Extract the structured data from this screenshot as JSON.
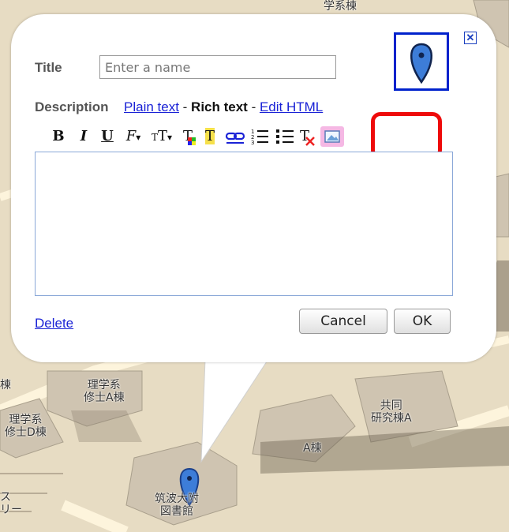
{
  "map": {
    "labels": {
      "top_building": "学系棟",
      "rigaku_shushi_a": "理学系\n修士A棟",
      "rigaku_shushi_d": "理学系\n修士D棟",
      "kyodo_kenkyu_a": "共同\n研究棟A",
      "a_building": "A棟",
      "library": "筑波大附\n図書館",
      "left_edge_1": "棟",
      "left_edge_2": "ス\nリー"
    },
    "colors": {
      "ground": "#e7dcc3",
      "building": "#cfc4b1",
      "road": "#fdf4dc",
      "pin": "#3d7dd8"
    }
  },
  "dialog": {
    "title_label": "Title",
    "title_placeholder": "Enter a name",
    "description_label": "Description",
    "mode_plain": "Plain text",
    "mode_rich": "Rich text",
    "mode_html": "Edit HTML",
    "mode_separator": " - ",
    "close_glyph": "✕",
    "toolbar": {
      "bold": "B",
      "italic": "I",
      "underline": "U",
      "font": "F",
      "font_size": "T",
      "text_color": "T",
      "highlight_color": "T",
      "link_icon": "link-icon",
      "numbered_list_icon": "numbered-list-icon",
      "bullet_list_icon": "bullet-list-icon",
      "remove_format_icon": "remove-formatting-icon",
      "insert_image_icon": "insert-image-icon"
    },
    "editor_content": "",
    "delete_label": "Delete",
    "cancel_label": "Cancel",
    "ok_label": "OK",
    "accent_colors": {
      "link": "#1a22d6",
      "pin_border": "#0022cc",
      "highlight": "#ee0a0a"
    }
  }
}
